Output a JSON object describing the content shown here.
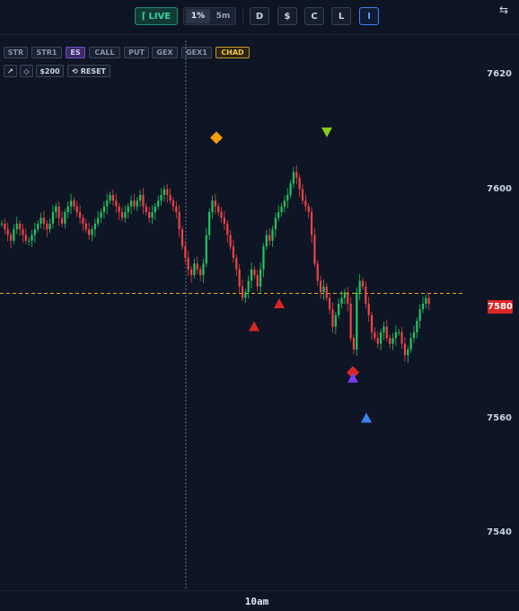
{
  "toolbar": {
    "live_label": "LIVE",
    "timeframes": [
      "1%",
      "5m"
    ],
    "buttons": [
      "D",
      "$",
      "C",
      "L",
      "I"
    ],
    "active_button": "I"
  },
  "filters": [
    "STR",
    "STR1",
    "ES",
    "CALL",
    "PUT",
    "GEX",
    "GEX1",
    "CHAD"
  ],
  "tools": {
    "amount": "$200",
    "reset": "RESET"
  },
  "colors": {
    "up": "#22c55e",
    "down": "#ef4444",
    "level_line": "#eab308",
    "accent": "#34d399"
  },
  "chart_data": {
    "type": "candlestick",
    "instrument": "ES",
    "y_ticks": [
      7620,
      7600,
      7580,
      7560,
      7540
    ],
    "y_range": [
      7530,
      7632
    ],
    "current_price": "7580",
    "level_line": 7581.8,
    "x_tick": "10am",
    "closes": [
      7594,
      7593,
      7592,
      7591,
      7593,
      7594,
      7593,
      7592,
      7591,
      7591,
      7592,
      7593,
      7594,
      7595,
      7594,
      7593,
      7594,
      7596,
      7597,
      7595,
      7594,
      7596,
      7597,
      7598,
      7597,
      7596,
      7595,
      7594,
      7593,
      7592,
      7593,
      7594,
      7595,
      7596,
      7597,
      7598,
      7599,
      7598,
      7597,
      7596,
      7595,
      7596,
      7597,
      7598,
      7597,
      7598,
      7599,
      7597,
      7596,
      7595,
      7596,
      7597,
      7598,
      7599,
      7600,
      7599,
      7598,
      7597,
      7596,
      7593,
      7590,
      7588,
      7586,
      7585,
      7587,
      7586,
      7585,
      7587,
      7592,
      7596,
      7598,
      7597,
      7596,
      7595,
      7594,
      7592,
      7590,
      7588,
      7586,
      7583,
      7581,
      7582,
      7584,
      7586,
      7585,
      7583,
      7586,
      7590,
      7592,
      7591,
      7593,
      7595,
      7596,
      7597,
      7598,
      7599,
      7601,
      7603,
      7602,
      7600,
      7598,
      7597,
      7596,
      7592,
      7587,
      7584,
      7582,
      7583,
      7581,
      7579,
      7576,
      7578,
      7580,
      7581,
      7582,
      7580,
      7574,
      7572,
      7582,
      7584,
      7583,
      7580,
      7578,
      7575,
      7574,
      7573,
      7575,
      7576,
      7574,
      7573,
      7574,
      7575,
      7575,
      7573,
      7571,
      7572,
      7574,
      7575,
      7577,
      7579,
      7580,
      7581,
      7580
    ],
    "markers": [
      {
        "type": "diamond",
        "color": "#f59e0b",
        "price": 7609
      },
      {
        "type": "triangle-down",
        "color": "#84cc16",
        "price": 7610
      },
      {
        "type": "triangle-up",
        "color": "#dc2626",
        "price": 7576
      },
      {
        "type": "triangle-up",
        "color": "#dc2626",
        "price": 7580
      },
      {
        "type": "diamond",
        "color": "#dc2626",
        "price": 7568
      },
      {
        "type": "triangle-up",
        "color": "#7c3aed",
        "price": 7567
      },
      {
        "type": "triangle-up",
        "color": "#3b82f6",
        "price": 7560
      }
    ]
  }
}
